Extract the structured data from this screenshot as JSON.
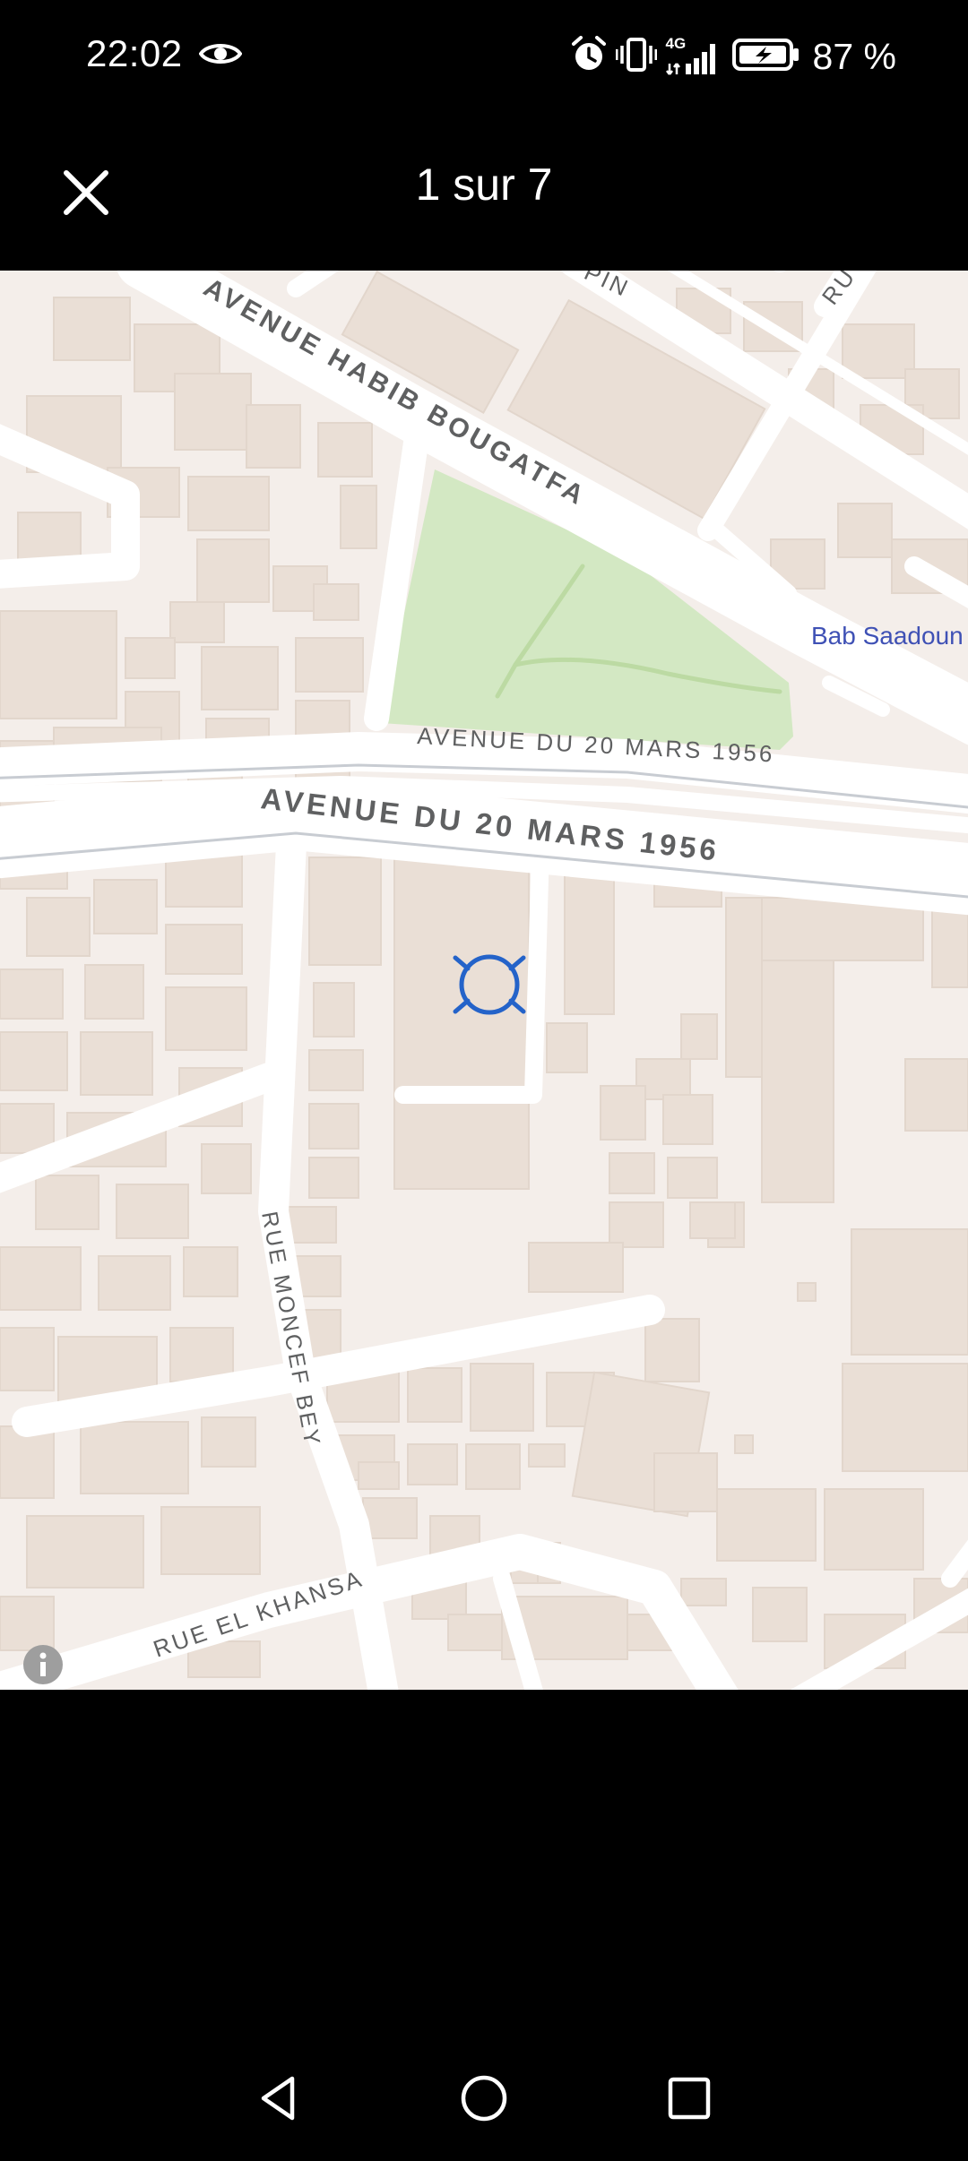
{
  "status_bar": {
    "time": "22:02",
    "network": "4G",
    "battery": "87 %"
  },
  "top_bar": {
    "page_counter": "1 sur 7"
  },
  "map": {
    "labels": {
      "avenue_habib_bougatfa": "AVENUE HABIB BOUGATFA",
      "avenue_20_mars_small": "AVENUE DU 20 MARS 1956",
      "avenue_20_mars_large": "AVENUE DU 20 MARS 1956",
      "rue_moncef_bey": "RUE MONCEF BEY",
      "rue_el_khansa": "RUE EL KHANSA",
      "bab_saadoun": "Bab Saadoun",
      "partial_top_pin": "PIN",
      "partial_top_right": "RU"
    },
    "colors": {
      "background": "#f4eeea",
      "building": "#eadfd6",
      "road": "#ffffff",
      "park": "#d3e8c3",
      "park_path": "#bcdaa3",
      "road_label": "#5f6061",
      "poi_label": "#3f51b5",
      "marker": "#2463c9"
    }
  },
  "icons": {
    "close": "close-icon",
    "eye": "eye-icon",
    "alarm": "alarm-icon",
    "vibrate": "vibrate-icon",
    "signal": "signal-icon",
    "battery": "battery-icon",
    "info": "info-icon",
    "marker": "location-target-icon",
    "back": "back-triangle-icon",
    "home": "home-circle-icon",
    "recents": "recents-square-icon"
  }
}
